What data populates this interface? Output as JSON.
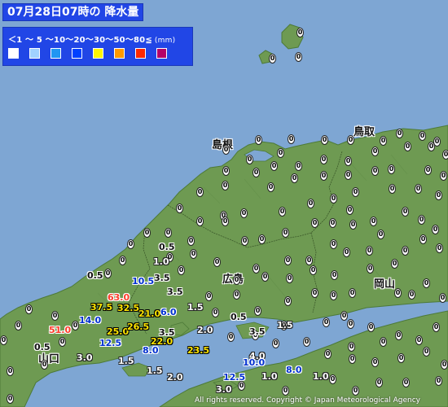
{
  "title": "07月28日07時の 降水量",
  "legend": {
    "scale_text": "＜1 〜 5 〜10〜20〜30〜50〜80≦",
    "unit": "(mm)",
    "colors": [
      "#ffffff",
      "#a0d2ff",
      "#2196f3",
      "#0041ff",
      "#fff500",
      "#ff9900",
      "#ff2800",
      "#b40068"
    ]
  },
  "prefectures": [
    {
      "id": "shimane",
      "label": "島根"
    },
    {
      "id": "tottori",
      "label": "鳥取"
    },
    {
      "id": "hiroshima",
      "label": "広島"
    },
    {
      "id": "okayama",
      "label": "岡山"
    },
    {
      "id": "yamaguchi",
      "label": "山口"
    }
  ],
  "zero_glyph": "0",
  "readings": [
    {
      "value": "0.5",
      "style": "black"
    },
    {
      "value": "1.0",
      "style": "white"
    },
    {
      "value": "0.5",
      "style": "black"
    },
    {
      "value": "10.5",
      "style": "blue"
    },
    {
      "value": "3.5",
      "style": "black"
    },
    {
      "value": "3.5",
      "style": "black"
    },
    {
      "value": "63.0",
      "style": "red"
    },
    {
      "value": "37.5",
      "style": "orange"
    },
    {
      "value": "32.5",
      "style": "orange"
    },
    {
      "value": "21.0",
      "style": "yellow"
    },
    {
      "value": "6.0",
      "style": "blue"
    },
    {
      "value": "1.5",
      "style": "white"
    },
    {
      "value": "14.0",
      "style": "blue"
    },
    {
      "value": "51.0",
      "style": "red"
    },
    {
      "value": "25.0",
      "style": "yellow"
    },
    {
      "value": "26.5",
      "style": "yellow"
    },
    {
      "value": "12.5",
      "style": "blue"
    },
    {
      "value": "22.0",
      "style": "yellow"
    },
    {
      "value": "3.5",
      "style": "black"
    },
    {
      "value": "2.0",
      "style": "white"
    },
    {
      "value": "3.5",
      "style": "black"
    },
    {
      "value": "1.5",
      "style": "white"
    },
    {
      "value": "8.0",
      "style": "blue"
    },
    {
      "value": "23.5",
      "style": "yellow"
    },
    {
      "value": "0.5",
      "style": "black"
    },
    {
      "value": "3.0",
      "style": "white"
    },
    {
      "value": "1.5",
      "style": "white"
    },
    {
      "value": "4.0",
      "style": "white"
    },
    {
      "value": "10.0",
      "style": "blue"
    },
    {
      "value": "8.0",
      "style": "blue"
    },
    {
      "value": "12.5",
      "style": "blue"
    },
    {
      "value": "1.0",
      "style": "white"
    },
    {
      "value": "1.0",
      "style": "white"
    },
    {
      "value": "1.5",
      "style": "white"
    },
    {
      "value": "2.0",
      "style": "white"
    },
    {
      "value": "3.0",
      "style": "white"
    },
    {
      "value": "0.5",
      "style": "black"
    }
  ],
  "copyright": "All rights reserved. Copyright © Japan Meteorological Agency"
}
